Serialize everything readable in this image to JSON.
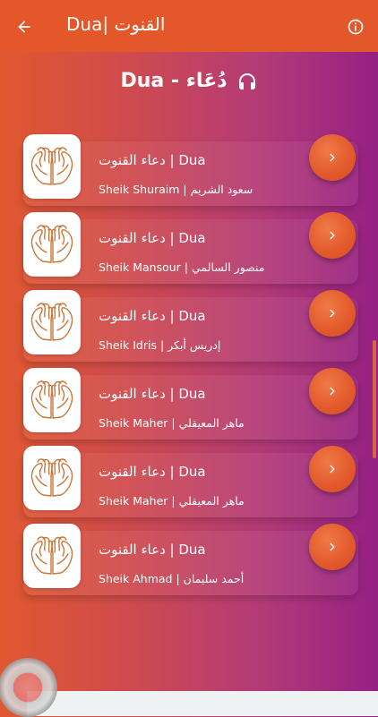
{
  "appbar": {
    "title": "القنوت |Dua",
    "back_icon": "arrow-left-icon",
    "info_icon": "info-circle-icon"
  },
  "section": {
    "title": "Dua - دُعَاء",
    "icon": "headphones-icon"
  },
  "items": [
    {
      "title": "دعاء القنوت | Dua",
      "subtitle": "Sheik Shuraim | سعود الشريم"
    },
    {
      "title": "دعاء القنوت | Dua",
      "subtitle": "Sheik Mansour | منصور السالمي"
    },
    {
      "title": "دعاء القنوت | Dua",
      "subtitle": "Sheik Idris | إدريس أبكر"
    },
    {
      "title": "دعاء القنوت | Dua",
      "subtitle": "Sheik Maher | ماهر المعيقلي"
    },
    {
      "title": "دعاء القنوت | Dua",
      "subtitle": "Sheik Maher | ماهر المعيقلي"
    },
    {
      "title": "دعاء القنوت | Dua",
      "subtitle": "Sheik Ahmad | أحمد سليمان"
    }
  ],
  "colors": {
    "appbar": "#e3572a",
    "accent": "#e2592b",
    "gradient_start": "#e0582f",
    "gradient_end": "#962083",
    "hands_stroke": "#c8773a"
  }
}
